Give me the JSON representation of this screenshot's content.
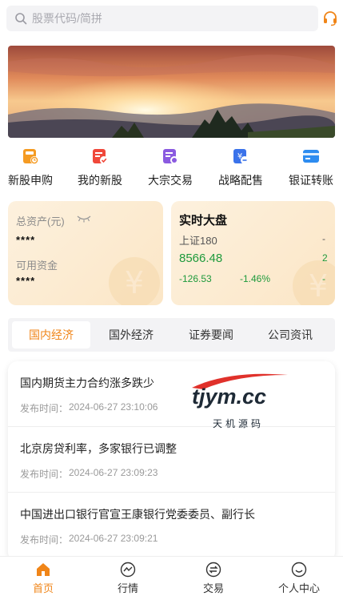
{
  "search": {
    "placeholder": "股票代码/简拼",
    "icon": "search-icon"
  },
  "header": {
    "service_icon": "headset-icon",
    "accent": "#f08518"
  },
  "quick_entries": [
    {
      "label": "新股申购",
      "icon": "ipo-icon",
      "color": "#f59b22"
    },
    {
      "label": "我的新股",
      "icon": "my-stock-icon",
      "color": "#f0483a"
    },
    {
      "label": "大宗交易",
      "icon": "block-trade-icon",
      "color": "#8a5ae0"
    },
    {
      "label": "战略配售",
      "icon": "strategic-placement-icon",
      "color": "#3a72ea"
    },
    {
      "label": "银证转账",
      "icon": "bank-transfer-icon",
      "color": "#2d8cf0"
    }
  ],
  "assets": {
    "total_label": "总资产(元)",
    "total_value": "****",
    "available_label": "可用资金",
    "available_value": "****"
  },
  "market": {
    "title": "实时大盘",
    "index_name": "上证180",
    "price": "8566.48",
    "change": "-126.53",
    "change_pct": "-1.46%",
    "edge_1": "-",
    "edge_2": "2",
    "edge_3": "-",
    "up_color": "#1e9a3c"
  },
  "news_tabs": [
    "国内经济",
    "国外经济",
    "证券要闻",
    "公司资讯"
  ],
  "news": [
    {
      "title": "国内期货主力合约涨多跌少",
      "time_label": "发布时间：",
      "time": "2024-06-27 23:10:06"
    },
    {
      "title": "北京房贷利率，多家银行已调整",
      "time_label": "发布时间：",
      "time": "2024-06-27 23:09:23"
    },
    {
      "title": "中国进出口银行官宣王康银行党委委员、副行长",
      "time_label": "发布时间：",
      "time": "2024-06-27 23:09:21"
    }
  ],
  "watermark": {
    "main": "tjym.cc",
    "sub": "天机源码"
  },
  "bottom_nav": [
    {
      "label": "首页",
      "icon": "home-icon"
    },
    {
      "label": "行情",
      "icon": "market-icon"
    },
    {
      "label": "交易",
      "icon": "trade-icon"
    },
    {
      "label": "个人中心",
      "icon": "profile-icon"
    }
  ]
}
